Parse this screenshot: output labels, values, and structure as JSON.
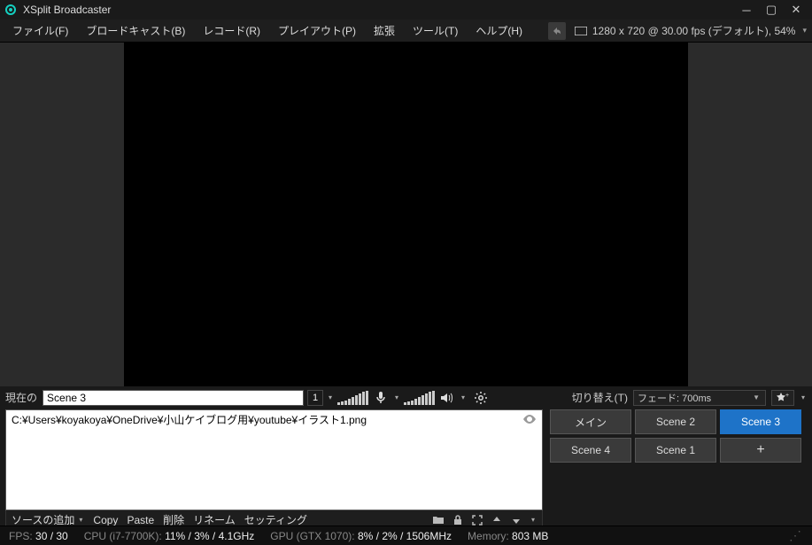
{
  "app": {
    "title": "XSplit Broadcaster"
  },
  "menu": {
    "file": "ファイル(F)",
    "broadcast": "ブロードキャスト(B)",
    "record": "レコード(R)",
    "playout": "プレイアウト(P)",
    "extensions": "拡張",
    "tools": "ツール(T)",
    "help": "ヘルプ(H)",
    "resolution_text": "1280 x 720 @ 30.00 fps (デフォルト), 54%"
  },
  "control": {
    "current_label": "現在の",
    "scene_name": "Scene 3",
    "num_badge": "1",
    "transition_label": "切り替え(T)",
    "transition_value": "フェード: 700ms"
  },
  "sources": {
    "items": [
      {
        "path": "C:¥Users¥koyakoya¥OneDrive¥小山ケイブログ用¥youtube¥イラスト1.png"
      }
    ],
    "toolbar": {
      "add": "ソースの追加",
      "copy": "Copy",
      "paste": "Paste",
      "delete": "削除",
      "rename": "リネーム",
      "settings": "セッティング"
    }
  },
  "scenes": {
    "buttons": [
      {
        "label": "メイン",
        "active": false
      },
      {
        "label": "Scene 2",
        "active": false
      },
      {
        "label": "Scene 3",
        "active": true
      },
      {
        "label": "Scene 4",
        "active": false
      },
      {
        "label": "Scene 1",
        "active": false
      },
      {
        "label": "+",
        "active": false,
        "add": true
      }
    ]
  },
  "status": {
    "fps_label": "FPS:",
    "fps_value": "30 / 30",
    "cpu_label": "CPU (i7-7700K):",
    "cpu_value": "11% / 3% / 4.1GHz",
    "gpu_label": "GPU (GTX 1070):",
    "gpu_value": "8% / 2% / 1506MHz",
    "mem_label": "Memory:",
    "mem_value": "803 MB"
  }
}
